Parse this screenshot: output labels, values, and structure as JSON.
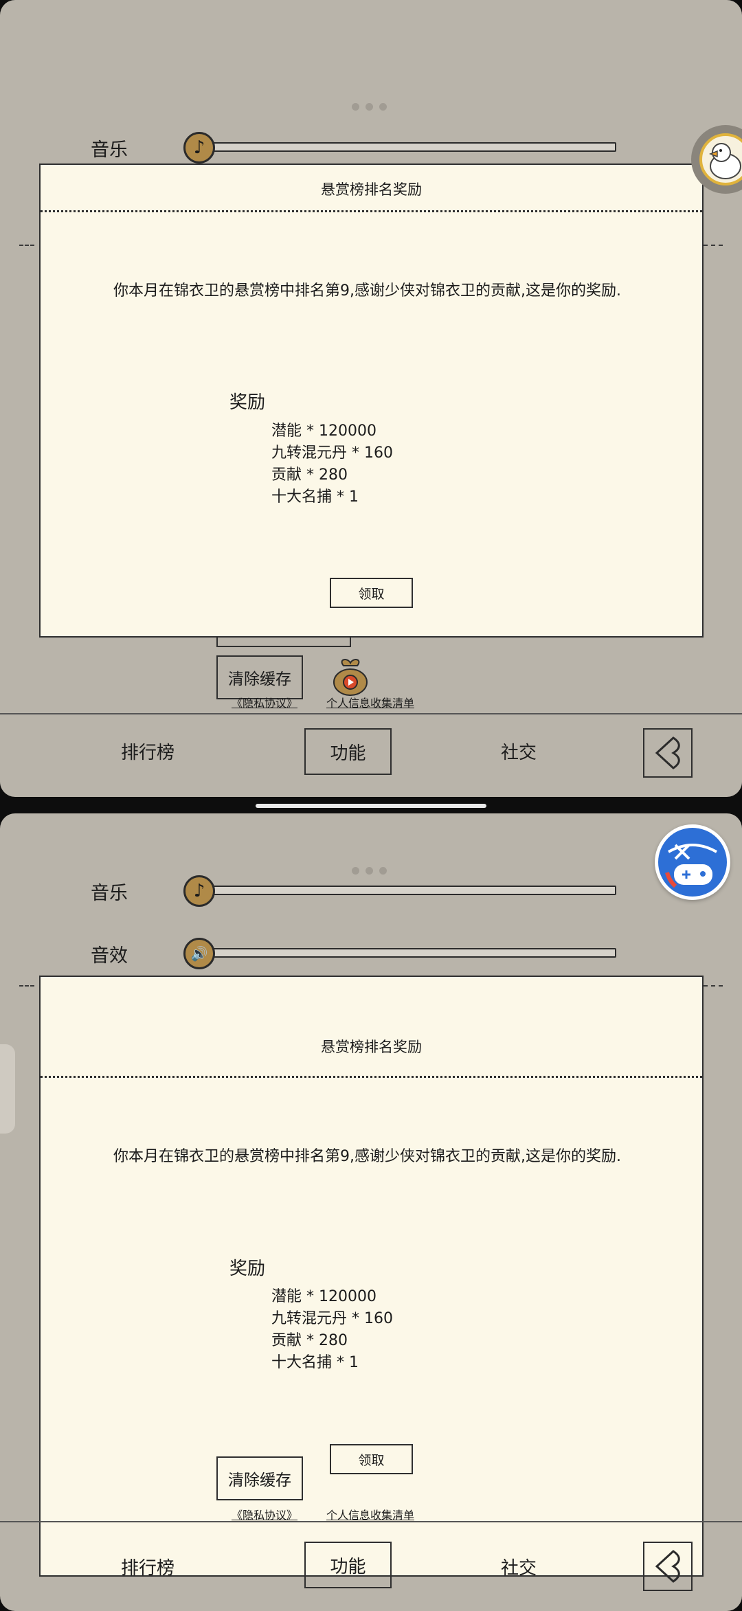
{
  "settings": {
    "music_label": "音乐",
    "effect_label": "音效",
    "clear_cache_label": "清除缓存",
    "privacy_link": "《隐私协议》",
    "info_link": "个人信息收集清单"
  },
  "dialog": {
    "title": "悬赏榜排名奖励",
    "message": "你本月在锦衣卫的悬赏榜中排名第9,感谢少侠对锦衣卫的贡献,这是你的奖励.",
    "reward_title": "奖励",
    "rewards": [
      "潜能  * 120000",
      "九转混元丹  * 160",
      "贡献  * 280",
      "十大名捕  * 1"
    ],
    "claim_label": "领取"
  },
  "nav": {
    "ranking": "排行榜",
    "function": "功能",
    "social": "社交"
  },
  "icons": {
    "music": "music-note-icon",
    "effect": "speaker-icon",
    "back": "back-arrow-icon",
    "avatar": "duck-avatar-icon",
    "game": "game-controller-badge-icon",
    "pouch": "gift-pouch-icon"
  },
  "colors": {
    "background": "#b9b4aa",
    "dialog": "#fcf8e8",
    "knob": "#b08a48"
  }
}
